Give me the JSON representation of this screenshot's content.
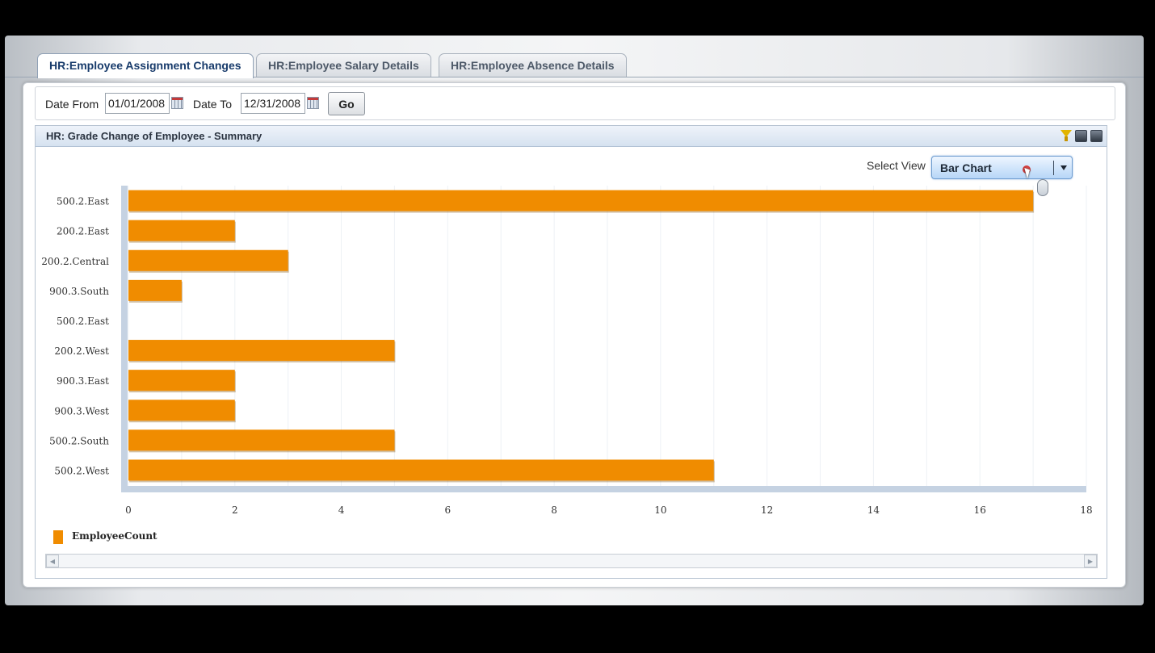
{
  "tabs": [
    {
      "label": "HR:Employee Assignment Changes",
      "active": true
    },
    {
      "label": "HR:Employee Salary Details",
      "active": false
    },
    {
      "label": "HR:Employee Absence Details",
      "active": false
    }
  ],
  "filters": {
    "date_from_label": "Date From",
    "date_from_value": "01/01/2008",
    "date_to_label": "Date To",
    "date_to_value": "12/31/2008",
    "go_label": "Go"
  },
  "chart_panel": {
    "title": "HR: Grade Change of Employee - Summary",
    "icons": [
      "filter-icon",
      "minimize-icon",
      "restore-icon"
    ],
    "select_view_label": "Select View",
    "select_view_value": "Bar Chart"
  },
  "colors": {
    "bar": "#f08c00",
    "axis": "#c5d2e2"
  },
  "chart_data": {
    "type": "bar",
    "orientation": "horizontal",
    "categories": [
      "500.2.East",
      "200.2.East",
      "200.2.Central",
      "900.3.South",
      "500.2.East",
      "200.2.West",
      "900.3.East",
      "900.3.West",
      "500.2.South",
      "500.2.West"
    ],
    "series": [
      {
        "name": "EmployeeCount",
        "values": [
          17,
          2,
          3,
          1,
          0,
          5,
          2,
          2,
          5,
          11
        ]
      }
    ],
    "xlim": [
      0,
      18
    ],
    "xticks": [
      0,
      2,
      4,
      6,
      8,
      10,
      12,
      14,
      16,
      18
    ],
    "grid": true,
    "legend": "bottom-left"
  }
}
